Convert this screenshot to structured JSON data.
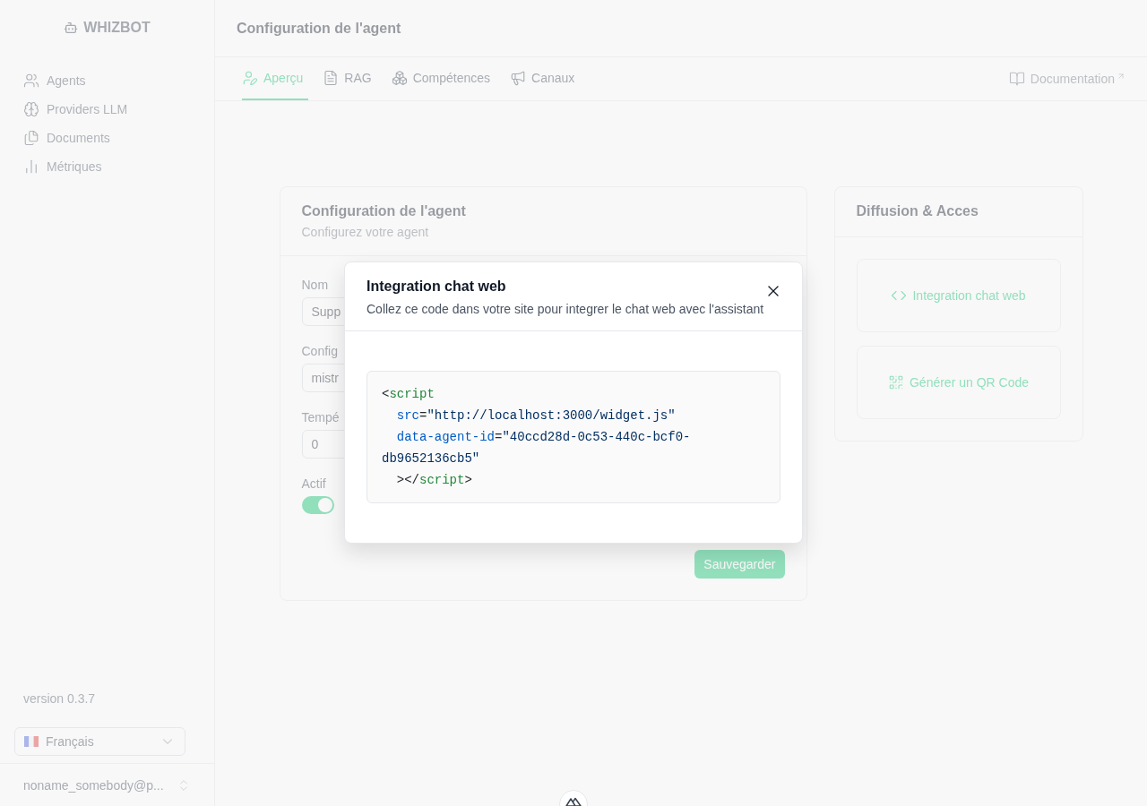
{
  "sidebar": {
    "logo": "WHIZBOT",
    "items": [
      {
        "label": "Agents"
      },
      {
        "label": "Providers LLM"
      },
      {
        "label": "Documents"
      },
      {
        "label": "Métriques"
      }
    ],
    "version": "version 0.3.7",
    "language": "Français",
    "user": "noname_somebody@p..."
  },
  "header": {
    "title": "Configuration de l'agent"
  },
  "tabs": [
    {
      "label": "Aperçu",
      "selected": true
    },
    {
      "label": "RAG",
      "selected": false
    },
    {
      "label": "Compétences",
      "selected": false
    },
    {
      "label": "Canaux",
      "selected": false
    }
  ],
  "doc_link": "Documentation",
  "agent_card": {
    "title": "Configuration de l'agent",
    "subtitle": "Configurez votre agent",
    "fields": [
      {
        "label": "Nom",
        "value": "Supp"
      },
      {
        "label": "Config",
        "value": "mistr"
      },
      {
        "label": "Tempé",
        "value": "0"
      }
    ],
    "active": {
      "label": "Actif",
      "on": true
    },
    "save_button": "Sauvegarder"
  },
  "diffusion_card": {
    "title": "Diffusion & Acces",
    "actions": [
      {
        "label": "Integration chat web"
      },
      {
        "label": "Générer un QR Code"
      }
    ]
  },
  "modal": {
    "title": "Integration chat web",
    "description": "Collez ce code dans votre site pour integrer le chat web avec l'assistant",
    "code_lines": [
      {
        "indented": false,
        "tokens": [
          {
            "kind": "punct",
            "text": "<"
          },
          {
            "kind": "tag",
            "text": "script"
          }
        ]
      },
      {
        "indented": true,
        "tokens": [
          {
            "kind": "attr",
            "text": "src"
          },
          {
            "kind": "punct",
            "text": "="
          },
          {
            "kind": "string",
            "text": "\"http://localhost:3000/widget.js\""
          }
        ]
      },
      {
        "indented": true,
        "tokens": [
          {
            "kind": "attr",
            "text": "data-agent-id"
          },
          {
            "kind": "punct",
            "text": "="
          },
          {
            "kind": "string",
            "text": "\"40ccd28d-0c53-440c-bcf0-db9652136cb5\""
          }
        ]
      },
      {
        "indented": true,
        "tokens": [
          {
            "kind": "punct",
            "text": "></"
          },
          {
            "kind": "tag",
            "text": "script"
          },
          {
            "kind": "punct",
            "text": ">"
          }
        ]
      }
    ]
  }
}
